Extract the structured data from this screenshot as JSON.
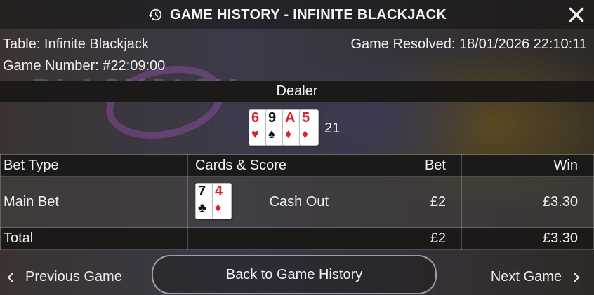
{
  "header": {
    "title": "GAME HISTORY - INFINITE BLACKJACK",
    "icon": "history-icon",
    "close_icon": "close-icon"
  },
  "info": {
    "table": "Table: Infinite Blackjack",
    "game_number": "Game Number: #22:09:00",
    "resolved": "Game Resolved: 18/01/2026 22:10:11"
  },
  "background": {
    "logo_text": "BLACKJACK"
  },
  "dealer": {
    "label": "Dealer",
    "cards": [
      {
        "rank": "6",
        "suit": "♥",
        "color": "#d8232a"
      },
      {
        "rank": "9",
        "suit": "♠",
        "color": "#111111"
      },
      {
        "rank": "A",
        "suit": "♦",
        "color": "#d8232a"
      },
      {
        "rank": "5",
        "suit": "♦",
        "color": "#d8232a"
      }
    ],
    "score": "21"
  },
  "bets": {
    "headers": {
      "bet_type": "Bet Type",
      "cards_score": "Cards & Score",
      "bet": "Bet",
      "win": "Win"
    },
    "main": {
      "bet_type": "Main Bet",
      "cards": [
        {
          "rank": "7",
          "suit": "♣",
          "color": "#111111"
        },
        {
          "rank": "4",
          "suit": "♦",
          "color": "#d8232a"
        }
      ],
      "result": "Cash Out",
      "bet": "£2",
      "win": "£3.30"
    },
    "total": {
      "label": "Total",
      "bet": "£2",
      "win": "£3.30"
    }
  },
  "footer": {
    "prev": "Previous Game",
    "back": "Back to Game History",
    "next": "Next Game"
  }
}
